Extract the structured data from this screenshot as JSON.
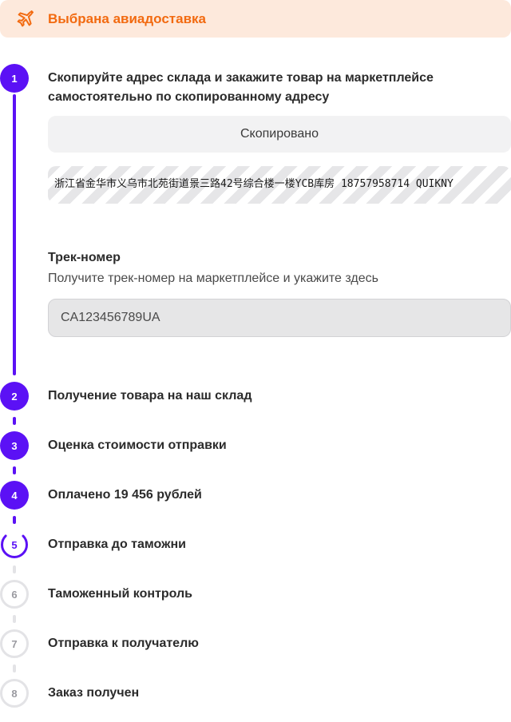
{
  "banner": {
    "icon": "airplane-icon",
    "label": "Выбрана авиадоставка",
    "accent": "#f26a10",
    "background": "#fde9dc"
  },
  "steps": [
    {
      "number": "1",
      "title_line1": "Скопируйте адрес склада и закажите товар на маркетплейсе",
      "title_line2": "самостоятельно по скопированному адресу",
      "state": "done"
    },
    {
      "number": "2",
      "title": "Получение товара на наш склад",
      "state": "done"
    },
    {
      "number": "3",
      "title": "Оценка стоимости отправки",
      "state": "done"
    },
    {
      "number": "4",
      "title": "Оплачено 19 456 рублей",
      "state": "done"
    },
    {
      "number": "5",
      "title": "Отправка до таможни",
      "state": "current"
    },
    {
      "number": "6",
      "title": "Таможенный контроль",
      "state": "pending"
    },
    {
      "number": "7",
      "title": "Отправка к получателю",
      "state": "pending"
    },
    {
      "number": "8",
      "title": "Заказ получен",
      "state": "pending"
    }
  ],
  "copy": {
    "button_label": "Скопировано",
    "address": "浙江省金华市义乌市北苑街道景三路42号综合楼一楼YCB库房 18757958714 QUIKNY"
  },
  "track": {
    "title": "Трек-номер",
    "hint": "Получите трек-номер на маркетплейсе и укажите здесь",
    "value": "CA123456789UA"
  },
  "colors": {
    "primary": "#5b11f5",
    "pending": "#e3e3e6"
  }
}
